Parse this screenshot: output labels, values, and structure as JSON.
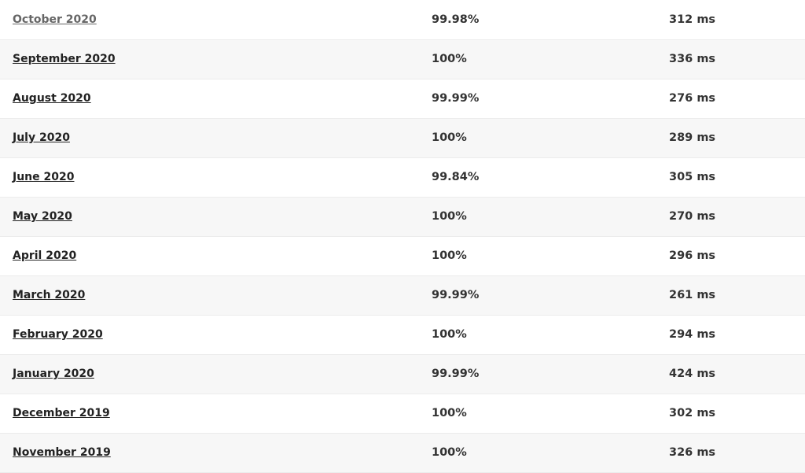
{
  "rows": [
    {
      "month": "October 2020",
      "uptime": "99.98%",
      "response": "312 ms"
    },
    {
      "month": "September 2020",
      "uptime": "100%",
      "response": "336 ms"
    },
    {
      "month": "August 2020",
      "uptime": "99.99%",
      "response": "276 ms"
    },
    {
      "month": "July 2020",
      "uptime": "100%",
      "response": "289 ms"
    },
    {
      "month": "June 2020",
      "uptime": "99.84%",
      "response": "305 ms"
    },
    {
      "month": "May 2020",
      "uptime": "100%",
      "response": "270 ms"
    },
    {
      "month": "April 2020",
      "uptime": "100%",
      "response": "296 ms"
    },
    {
      "month": "March 2020",
      "uptime": "99.99%",
      "response": "261 ms"
    },
    {
      "month": "February 2020",
      "uptime": "100%",
      "response": "294 ms"
    },
    {
      "month": "January 2020",
      "uptime": "99.99%",
      "response": "424 ms"
    },
    {
      "month": "December 2019",
      "uptime": "100%",
      "response": "302 ms"
    },
    {
      "month": "November 2019",
      "uptime": "100%",
      "response": "326 ms"
    }
  ]
}
